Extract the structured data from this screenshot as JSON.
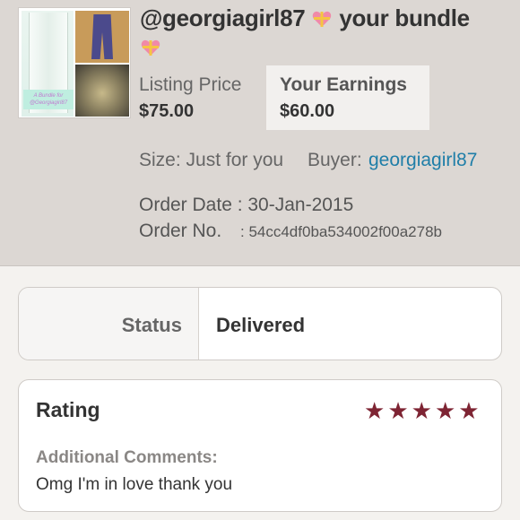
{
  "header": {
    "username": "@georgiagirl87",
    "bundle_text": "your bundle",
    "emoji_icon": "gift-heart-icon",
    "thumbnail_caption": "A Bundle for @Georgiagirl87"
  },
  "pricing": {
    "listing_price_label": "Listing Price",
    "listing_price_value": "$75.00",
    "earnings_label": "Your Earnings",
    "earnings_value": "$60.00"
  },
  "details": {
    "size": "Size: Just for you",
    "buyer_label": "Buyer:",
    "buyer_name": "georgiagirl87",
    "order_date": "Order Date : 30-Jan-2015",
    "order_no_label": "Order No.",
    "order_no_value": ": 54cc4df0ba534002f00a278b"
  },
  "status": {
    "label": "Status",
    "value": "Delivered"
  },
  "rating": {
    "label": "Rating",
    "stars": 5,
    "comments_label": "Additional Comments:",
    "comments_text": "Omg I'm in love thank you"
  },
  "colors": {
    "header_bg": "#dcd7d3",
    "link": "#1f7ea8",
    "star": "#7e2433"
  }
}
